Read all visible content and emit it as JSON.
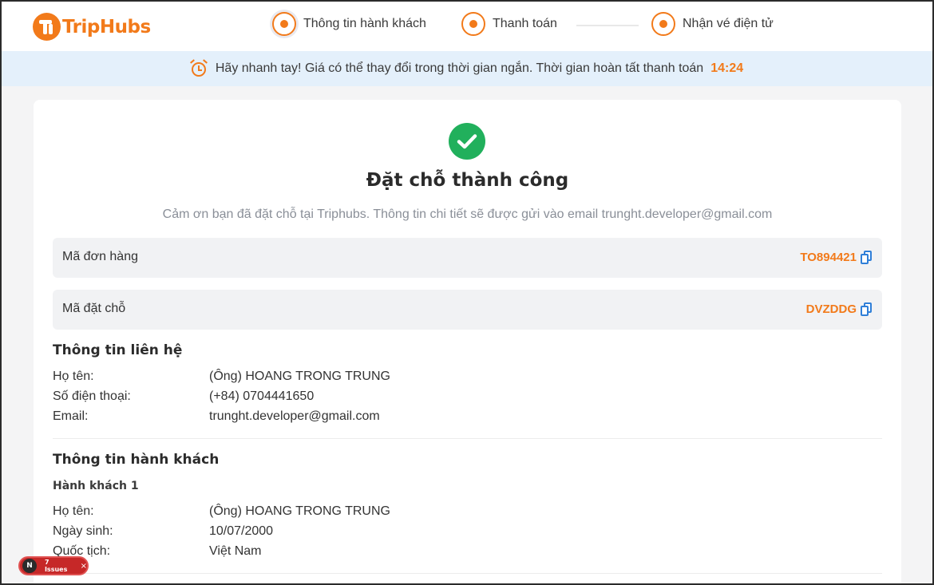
{
  "header": {
    "brand": "TripHubs",
    "steps": [
      {
        "label": "Thông tin hành khách"
      },
      {
        "label": "Thanh toán"
      },
      {
        "label": "Nhận vé điện tử"
      }
    ]
  },
  "timer": {
    "message": "Hãy nhanh tay! Giá có thể thay đổi trong thời gian ngắn. Thời gian hoàn tất thanh toán",
    "countdown": "14:24"
  },
  "success": {
    "title": "Đặt chỗ thành công",
    "subtitle": "Cảm ơn bạn đã đặt chỗ tại Triphubs. Thông tin chi tiết sẽ được gửi vào email trunght.developer@gmail.com"
  },
  "codes": [
    {
      "label": "Mã đơn hàng",
      "value": "TO894421"
    },
    {
      "label": "Mã đặt chỗ",
      "value": "DVZDDG"
    }
  ],
  "contact": {
    "title": "Thông tin liên hệ",
    "rows": [
      {
        "label": "Họ tên:",
        "value": "(Ông) HOANG TRONG TRUNG"
      },
      {
        "label": "Số điện thoại:",
        "value": "(+84) 0704441650"
      },
      {
        "label": "Email:",
        "value": "trunght.developer@gmail.com"
      }
    ]
  },
  "passengers": {
    "title": "Thông tin hành khách",
    "items": [
      {
        "heading": "Hành khách 1",
        "rows": [
          {
            "label": "Họ tên:",
            "value": "(Ông) HOANG TRONG TRUNG"
          },
          {
            "label": "Ngày sinh:",
            "value": "10/07/2000"
          },
          {
            "label": "Quốc tịch:",
            "value": "Việt Nam"
          }
        ]
      }
    ]
  },
  "dev_badge": {
    "letter": "N",
    "text": "7 Issues",
    "close": "×"
  },
  "colors": {
    "accent": "#f27a1a",
    "success": "#21b05c",
    "timer_bg": "#e4f0fb",
    "copy_icon": "#2f7fd8"
  }
}
